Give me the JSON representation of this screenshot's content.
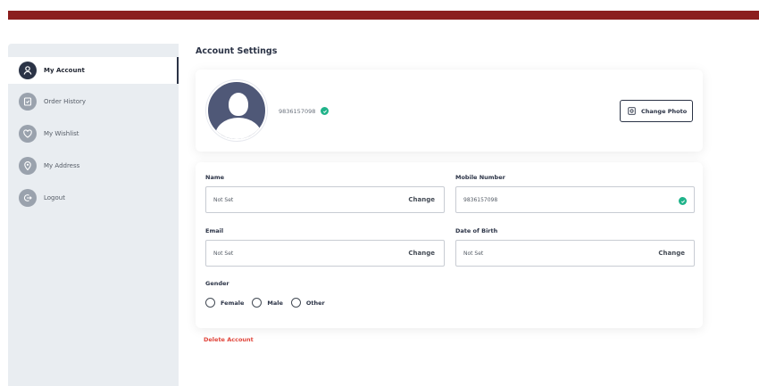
{
  "colors": {
    "header_bar": "#8b1e1e",
    "sidebar_bg": "#e9edf1",
    "accent": "#2b3346",
    "verified": "#20b38a",
    "danger": "#e0443a"
  },
  "sidebar": {
    "items": [
      {
        "label": "My Account",
        "icon": "user-icon",
        "active": true
      },
      {
        "label": "Order History",
        "icon": "order-history-icon",
        "active": false
      },
      {
        "label": "My Wishlist",
        "icon": "heart-icon",
        "active": false
      },
      {
        "label": "My Address",
        "icon": "location-pin-icon",
        "active": false
      },
      {
        "label": "Logout",
        "icon": "logout-icon",
        "active": false
      }
    ]
  },
  "page": {
    "title": "Account Settings"
  },
  "profile": {
    "phone": "9836157098",
    "change_photo_label": "Change Photo"
  },
  "form": {
    "name": {
      "label": "Name",
      "value": "Not Set",
      "action": "Change"
    },
    "mobile": {
      "label": "Mobile Number",
      "value": "9836157098"
    },
    "email": {
      "label": "Email",
      "value": "Not Set",
      "action": "Change"
    },
    "dob": {
      "label": "Date of Birth",
      "value": "Not Set",
      "action": "Change"
    },
    "gender": {
      "label": "Gender",
      "options": [
        "Female",
        "Male",
        "Other"
      ]
    }
  },
  "delete_account_label": "Delete Account"
}
